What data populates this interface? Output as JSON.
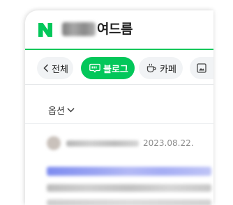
{
  "header": {
    "logo_icon": "naver-n-logo",
    "title_suffix": "여드름",
    "accent_color": "#03c75a"
  },
  "tabs": [
    {
      "label": "전체",
      "icon": "chevron-left-icon",
      "active": false
    },
    {
      "label": "블로그",
      "icon": "blog-chat-icon",
      "active": true
    },
    {
      "label": "카페",
      "icon": "coffee-cup-icon",
      "active": false
    },
    {
      "label": "",
      "icon": "image-icon",
      "active": false
    }
  ],
  "options": {
    "label": "옵션",
    "icon": "chevron-down-icon"
  },
  "result": {
    "date": "2023.08.22."
  }
}
